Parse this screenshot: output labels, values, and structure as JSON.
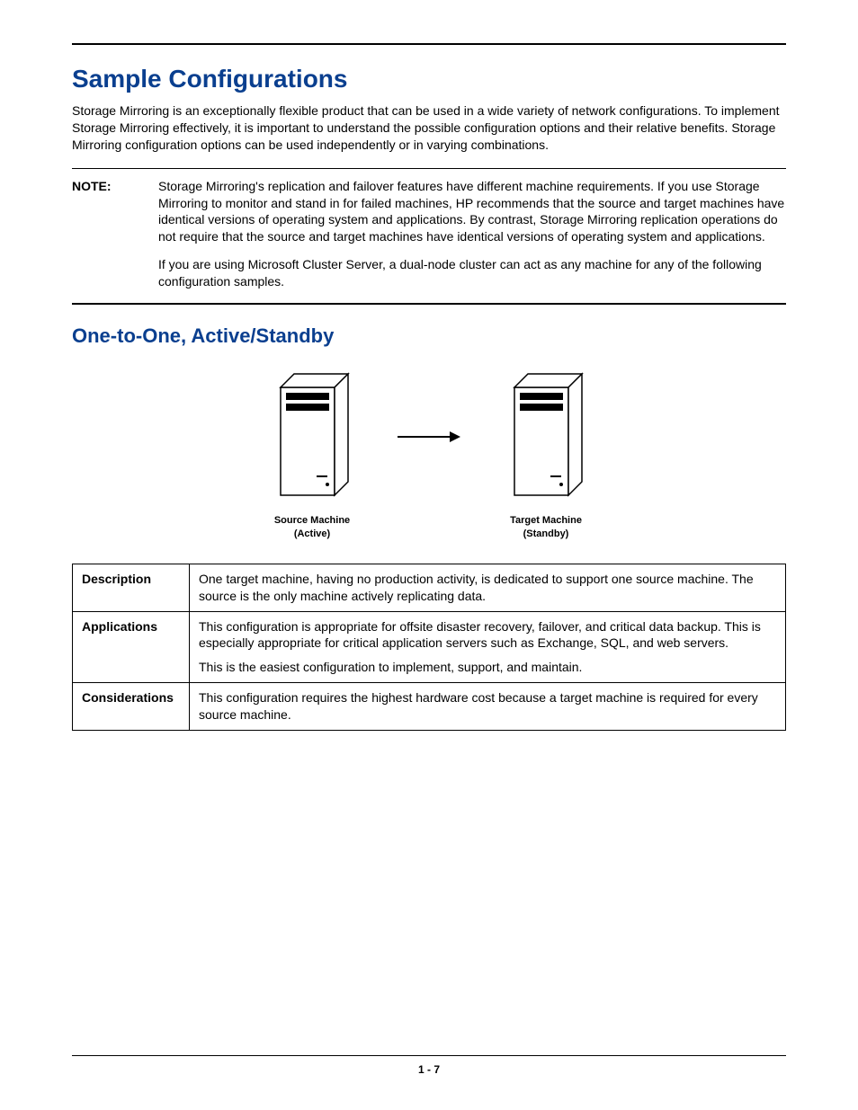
{
  "heading": "Sample Configurations",
  "intro": "Storage Mirroring is an exceptionally flexible product that can be used in a wide variety of network configurations. To implement Storage Mirroring effectively, it is important to understand the possible configuration options and their relative benefits.  Storage Mirroring configuration options can be used independently or in varying combinations.",
  "note": {
    "label": "NOTE:",
    "para1": "Storage Mirroring's replication and failover features have different machine requirements. If you use Storage Mirroring to monitor and stand in for failed machines, HP recommends that the source and target machines have identical versions of operating system and applications. By contrast, Storage Mirroring replication operations do not require that the source and target machines have identical versions of operating system and applications.",
    "para2": "If you are using Microsoft Cluster Server, a dual-node cluster can act as any machine for any of the following configuration samples."
  },
  "subheading": "One-to-One, Active/Standby",
  "diagram": {
    "source_line1": "Source Machine",
    "source_line2": "(Active)",
    "target_line1": "Target Machine",
    "target_line2": "(Standby)"
  },
  "table": {
    "row1_label": "Description",
    "row1_text": "One target machine, having no production activity, is dedicated to support one source machine. The source is the only machine actively replicating data.",
    "row2_label": "Applications",
    "row2_p1": "This configuration is appropriate for offsite disaster recovery, failover, and critical data backup. This is especially appropriate for critical application servers such as Exchange, SQL, and web servers.",
    "row2_p2": "This is the easiest configuration to implement, support, and maintain.",
    "row3_label": "Considerations",
    "row3_text": "This configuration requires the highest hardware cost because a target machine is required for every source machine."
  },
  "page_number": "1 - 7"
}
